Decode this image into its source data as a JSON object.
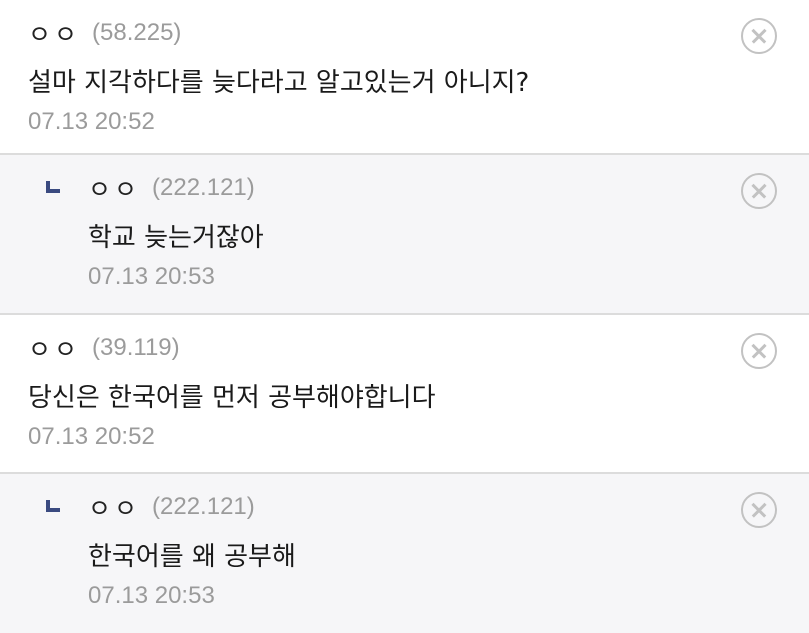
{
  "comments": [
    {
      "nickname": "ㅇㅇ",
      "ip": "(58.225)",
      "text": "설마 지각하다를 늦다라고 알고있는거 아니지?",
      "time": "07.13 20:52",
      "is_reply": false,
      "delete_icon": "close-circle-icon"
    },
    {
      "nickname": "ㅇㅇ",
      "ip": "(222.121)",
      "text": "학교 늦는거잖아",
      "time": "07.13 20:53",
      "is_reply": true,
      "reply_icon": "reply-arrow-icon",
      "delete_icon": "close-circle-icon"
    },
    {
      "nickname": "ㅇㅇ",
      "ip": "(39.119)",
      "text": "당신은 한국어를 먼저 공부해야합니다",
      "time": "07.13 20:52",
      "is_reply": false,
      "delete_icon": "close-circle-icon"
    },
    {
      "nickname": "ㅇㅇ",
      "ip": "(222.121)",
      "text": "한국어를 왜 공부해",
      "time": "07.13 20:53",
      "is_reply": true,
      "reply_icon": "reply-arrow-icon",
      "delete_icon": "close-circle-icon"
    }
  ],
  "colors": {
    "reply_background": "#f6f6f8",
    "reply_arrow": "#3a4a80",
    "meta_text": "#9b9b9b",
    "divider": "#dcdcdc"
  }
}
